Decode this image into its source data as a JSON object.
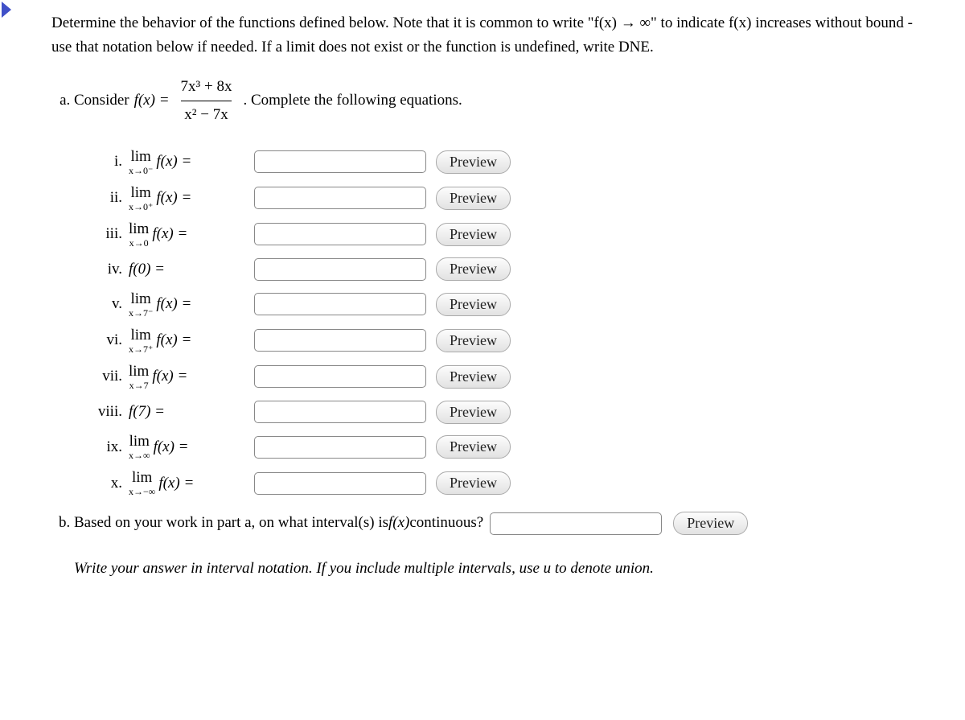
{
  "prompt": "Determine the behavior of the functions defined below. Note that it is common to write \"f(x) → ∞\" to indicate f(x) increases without bound - use that notation below if needed. If a limit does not exist or the function is undefined, write DNE.",
  "part_a": {
    "lead": "Consider ",
    "fx_eq": "f(x) = ",
    "numerator": "7x³ + 8x",
    "denominator": "x² − 7x",
    "trail": ". Complete the following equations.",
    "items": [
      {
        "rn": "i.",
        "lim_top": "lim",
        "lim_bot": "x→0⁻",
        "fx": "f(x) =",
        "value": ""
      },
      {
        "rn": "ii.",
        "lim_top": "lim",
        "lim_bot": "x→0⁺",
        "fx": "f(x) =",
        "value": ""
      },
      {
        "rn": "iii.",
        "lim_top": "lim",
        "lim_bot": "x→0",
        "fx": "f(x) =",
        "value": ""
      },
      {
        "rn": "iv.",
        "lim_top": "",
        "lim_bot": "",
        "fx": "f(0) =",
        "value": ""
      },
      {
        "rn": "v.",
        "lim_top": "lim",
        "lim_bot": "x→7⁻",
        "fx": "f(x) =",
        "value": ""
      },
      {
        "rn": "vi.",
        "lim_top": "lim",
        "lim_bot": "x→7⁺",
        "fx": "f(x) =",
        "value": ""
      },
      {
        "rn": "vii.",
        "lim_top": "lim",
        "lim_bot": "x→7",
        "fx": "f(x) =",
        "value": ""
      },
      {
        "rn": "viii.",
        "lim_top": "",
        "lim_bot": "",
        "fx": "f(7) =",
        "value": ""
      },
      {
        "rn": "ix.",
        "lim_top": "lim",
        "lim_bot": "x→∞",
        "fx": "f(x) =",
        "value": ""
      },
      {
        "rn": "x.",
        "lim_top": "lim",
        "lim_bot": "x→−∞",
        "fx": "f(x) =",
        "value": ""
      }
    ]
  },
  "part_b": {
    "text_before": "Based on your work in part a, on what interval(s) is ",
    "fx": "f(x)",
    "text_after": " continuous?",
    "value": "",
    "hint": "Write your answer in interval notation. If you include multiple intervals, use u to denote union."
  },
  "preview_label": "Preview"
}
